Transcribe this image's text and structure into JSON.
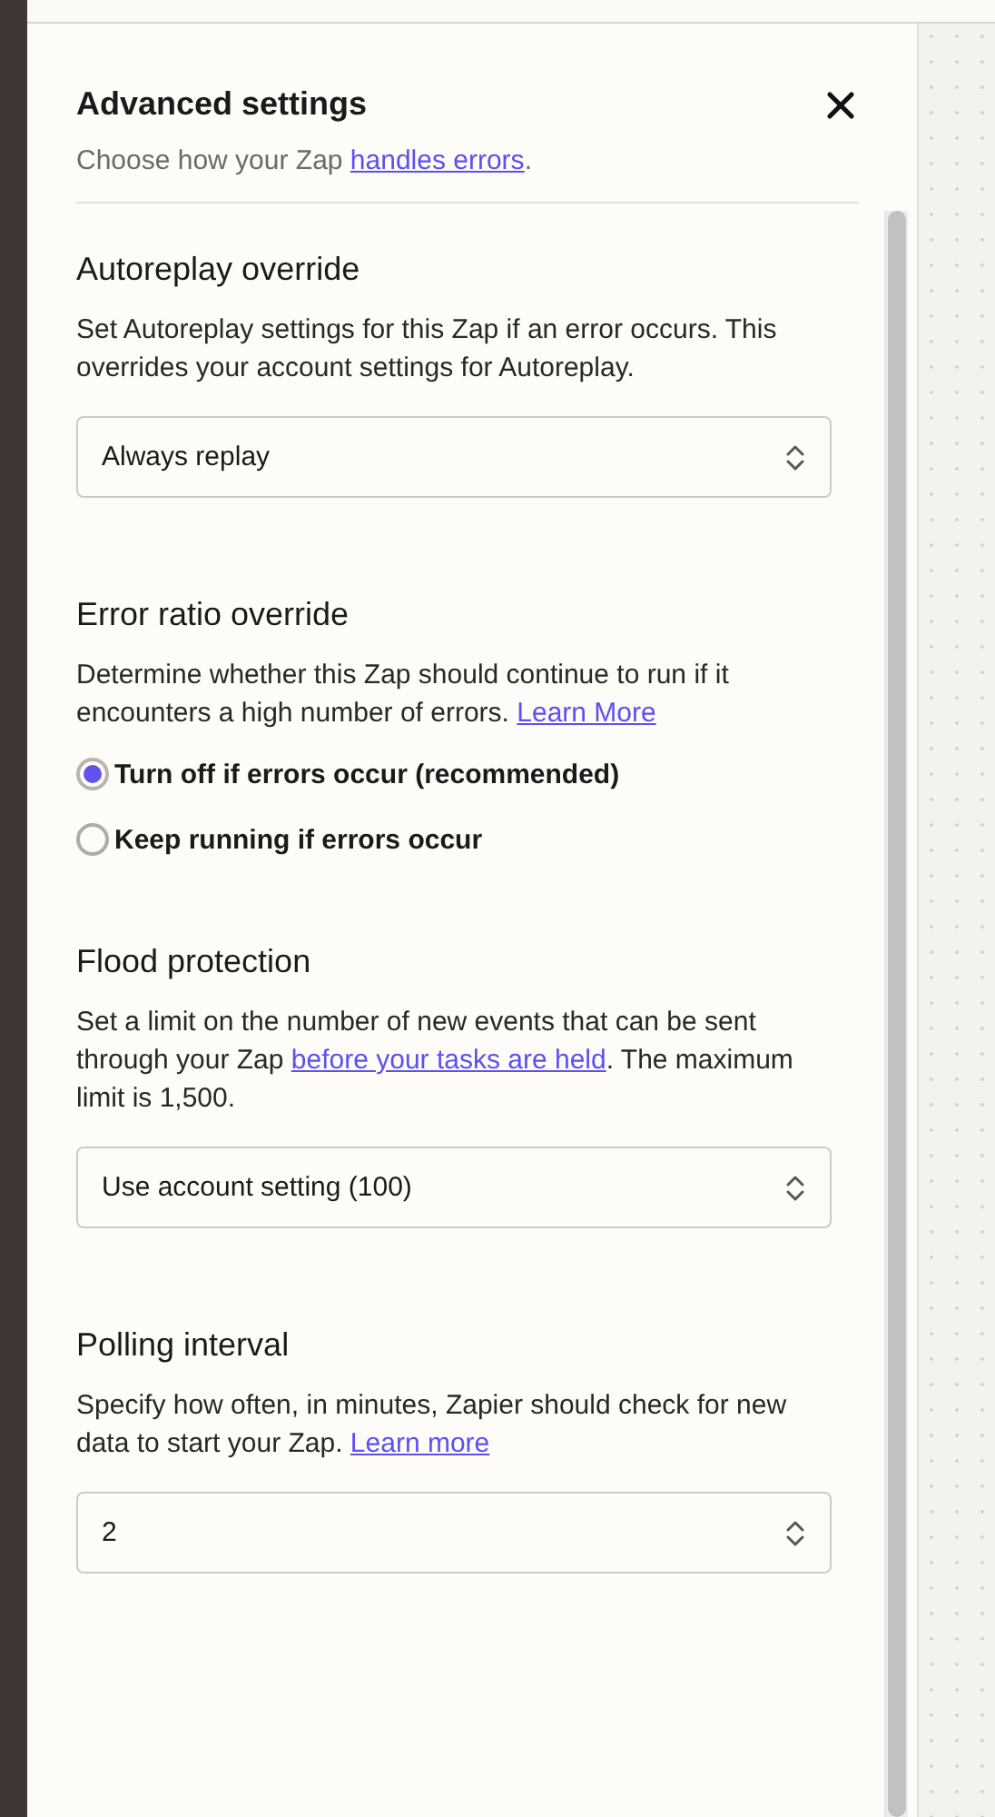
{
  "panel": {
    "title": "Advanced settings",
    "subtitle": {
      "before": "Choose how your Zap ",
      "link": "handles errors",
      "after": "."
    }
  },
  "sections": [
    {
      "kind": "select",
      "title": "Autoreplay override",
      "description": {
        "before": "Set Autoreplay settings for this Zap if an error occurs. This overrides your account settings for Autoreplay."
      },
      "value": "Always replay"
    },
    {
      "kind": "radio",
      "title": "Error ratio override",
      "description": {
        "before": "Determine whether this Zap should continue to run if it encounters a high number of errors. ",
        "link": "Learn More"
      },
      "options": [
        {
          "label": "Turn off if errors occur (recommended)",
          "selected": true
        },
        {
          "label": "Keep running if errors occur",
          "selected": false
        }
      ]
    },
    {
      "kind": "select",
      "title": "Flood protection",
      "description": {
        "before": "Set a limit on the number of new events that can be sent through your Zap ",
        "link": "before your tasks are held",
        "after": ". The maximum limit is 1,500."
      },
      "value": "Use account setting (100)"
    },
    {
      "kind": "select",
      "title": "Polling interval",
      "description": {
        "before": "Specify how often, in minutes, Zapier should check for new data to start your Zap. ",
        "link": "Learn more"
      },
      "value": "2"
    }
  ]
}
